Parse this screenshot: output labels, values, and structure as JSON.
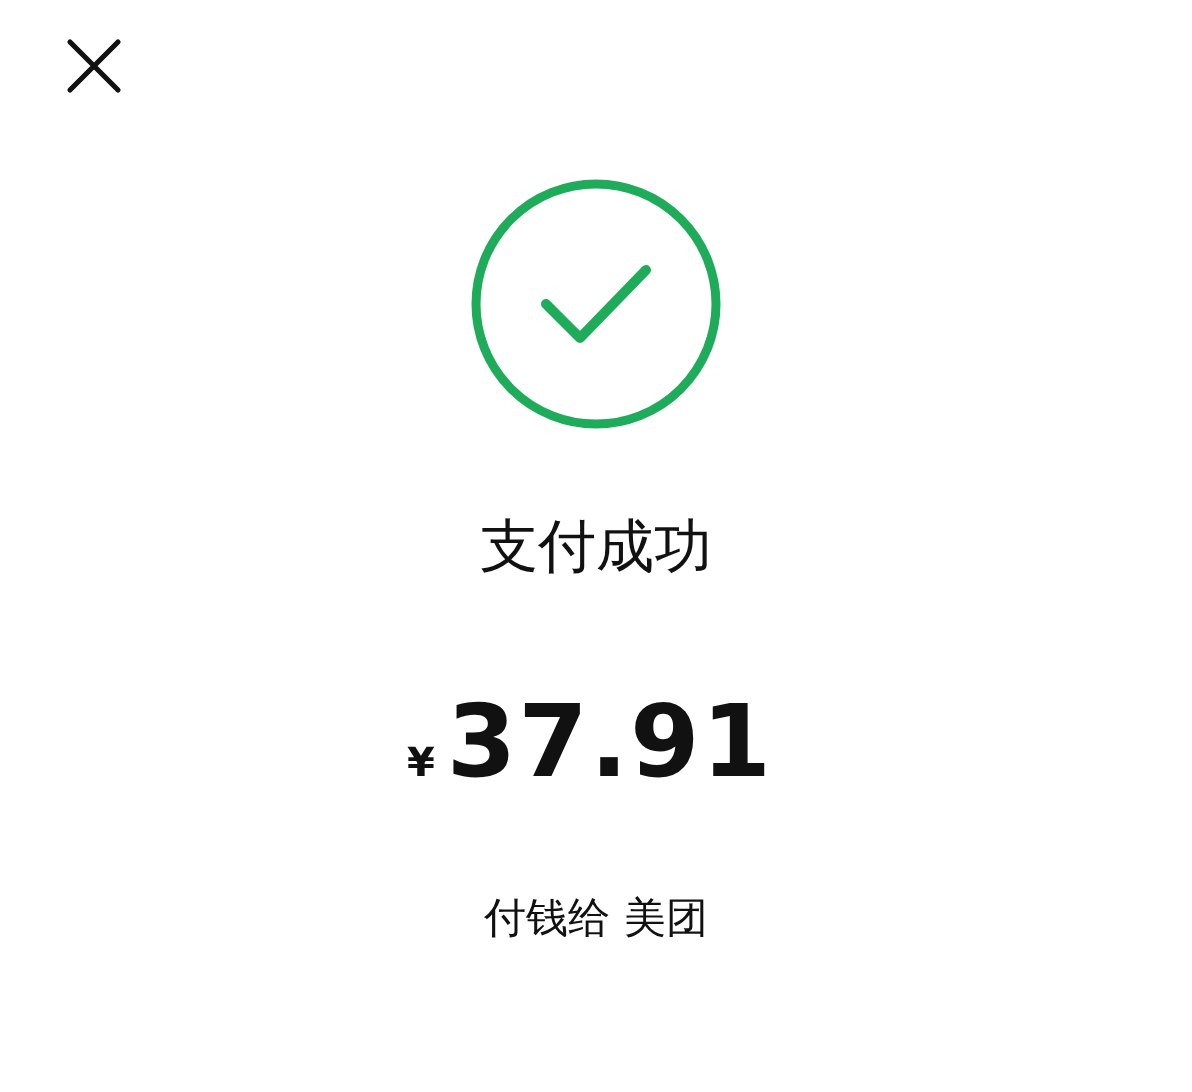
{
  "title": "支付成功",
  "amount": {
    "currency": "¥",
    "value": "37.91"
  },
  "payee": "付钱给 美团"
}
